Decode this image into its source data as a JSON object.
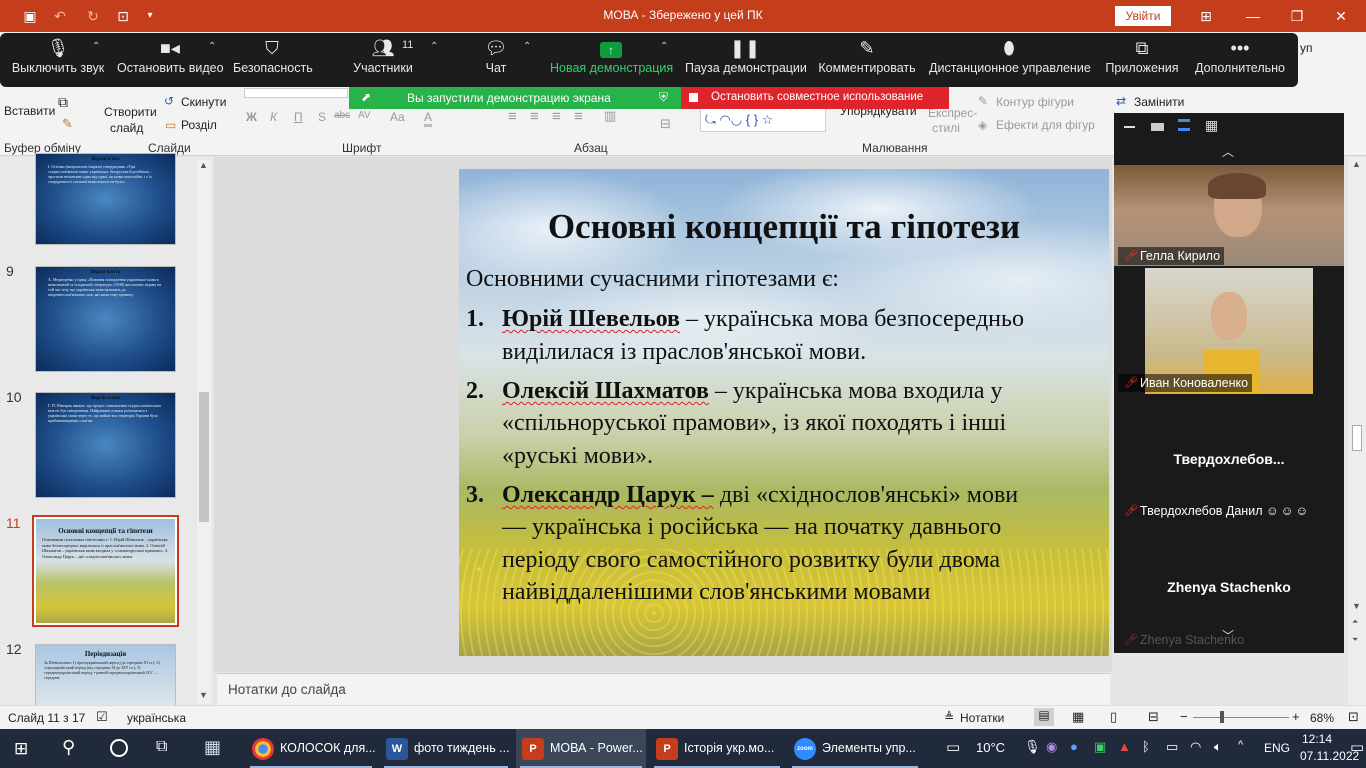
{
  "window": {
    "title": "МОВА  -  Збережено у цей ПК",
    "signin_label": "Увійти"
  },
  "ribbon": {
    "paste": "Вставити",
    "new_slide_1": "Створити",
    "new_slide_2": "слайд",
    "reset": "Скинути",
    "section": "Розділ",
    "group_clipboard": "Буфер обміну",
    "group_slides": "Слайди",
    "group_font": "Шрифт",
    "group_paragraph": "Абзац",
    "group_drawing": "Малювання",
    "arrange": "Упорядкувати",
    "quick_styles_1": "Експрес-",
    "quick_styles_2": "стилі",
    "shape_outline": "Контур фігури",
    "shape_effects": "Ефекти для фігур",
    "replace": "Замінити",
    "group_partial": "уп",
    "font_buttons": [
      "Ж",
      "К",
      "П",
      "S",
      "abc",
      "AV",
      "Aa",
      "A"
    ]
  },
  "zoom_toolbar": {
    "mute": "Выключить звук",
    "stop_video": "Остановить видео",
    "security": "Безопасность",
    "participants": "Участники",
    "participants_count": "11",
    "chat": "Чат",
    "new_share": "Новая демонстрация",
    "pause_share": "Пауза демонстрации",
    "annotate": "Комментировать",
    "remote_control": "Дистанционное управление",
    "apps": "Приложения",
    "more": "Дополнительно",
    "sharing_notice": "Вы запустили демонстрацию экрана",
    "stop_share": "Остановить совместное использование"
  },
  "thumbnails": [
    {
      "num": "",
      "title": "Версія п'ята",
      "body": "І. Огієнко (митрополит Іларіон) стверджував: «Три східнослов'янські мови: українська, білоруська й російська – зростали незалежно одна від одної, як мови самостійні, і є їх спорідненості спільної мови взагалі не було»."
    },
    {
      "num": "9",
      "title": "Версія шоста",
      "body": "А. Медведенко у праці «Питання походження української мови в мовознавчій та історичній літературі» (1938) висловлює відому на той час тезу, що українська мова належить до південнослов'янських мов, які мали тому правилу."
    },
    {
      "num": "10",
      "title": "Версія сьома",
      "body": "Г. П. Півторак вважає, що процес становлення східнослов'янських мов не був синхронним. Найранішні ознаки розпочатися з української мови через те, що майже вся територія України була прабатьківщиною слов'ян."
    },
    {
      "num": "11",
      "title": "Основні концепції та гіпотези",
      "body": "Основними сучасними гіпотезами є: 1. Юрій Шевельов – українська мова безпосередньо виділилася із праслов'янської мови. 2. Олексій Шахматов – українська мова входила у «спільноруської прамови». 3. Олександр Царук – дві «східнослов'янські» мови."
    },
    {
      "num": "12",
      "title": "Періодизація",
      "body": "За Шевельовим: 1) протоукраїнський період (до середини XI ст.); 2) староукраїнський період (від середини XI до XIV ст.); 3) середньоукраїнський період; • ранній середньоукраїнський (XV — середина"
    }
  ],
  "slide": {
    "title": "Основні концепції та гіпотези",
    "intro": "Основними сучасними гіпотезами є:",
    "items": [
      {
        "num": "1.",
        "name": "Юрій Шевельов",
        "line1": " – українська мова безпосередньо",
        "rest": [
          "виділилася із праслов'янської мови."
        ]
      },
      {
        "num": "2.",
        "name": "Олексій Шахматов",
        "line1": " – українська мова входила у",
        "rest": [
          "«спільноруської прамови», із якої походять і інші",
          "«руські мови»."
        ]
      },
      {
        "num": "3.",
        "name": "Олександр Царук –",
        "line1": " дві «східнослов'янські» мови",
        "rest": [
          "— українська і російська — на початку давнього",
          "періоду свого самостійного розвитку були двома",
          "найвіддаленішими слов'янськими мовами"
        ]
      }
    ]
  },
  "notes_placeholder": "Нотатки до слайда",
  "gallery": {
    "participants": [
      {
        "name": "Гелла Кирило"
      },
      {
        "name": "Иван Коноваленко"
      },
      {
        "name": "Твердохлебов...",
        "label": "Твердохлебов Данил"
      },
      {
        "name": "Zhenya Stachenko",
        "label": "Zhenya Stachenko"
      }
    ]
  },
  "status": {
    "slide_info": "Слайд 11 з 17",
    "language": "українська",
    "notes": "Нотатки",
    "zoom": "68%"
  },
  "taskbar": {
    "apps": [
      {
        "label": "КОЛОСОК для...",
        "icon": "chrome"
      },
      {
        "label": "фото тиждень ...",
        "icon": "W"
      },
      {
        "label": "МОВА - Power...",
        "icon": "P"
      },
      {
        "label": "Історія укр.мо...",
        "icon": "P"
      },
      {
        "label": "Элементы упр...",
        "icon": "zoom"
      }
    ],
    "weather": "10°C",
    "lang": "ENG",
    "time": "12:14",
    "date": "07.11.2022"
  },
  "colors": {
    "accent": "#c43e1c",
    "zoom_bg": "#1c1c1c",
    "share_green": "#27b24a",
    "share_red": "#e0242b"
  }
}
